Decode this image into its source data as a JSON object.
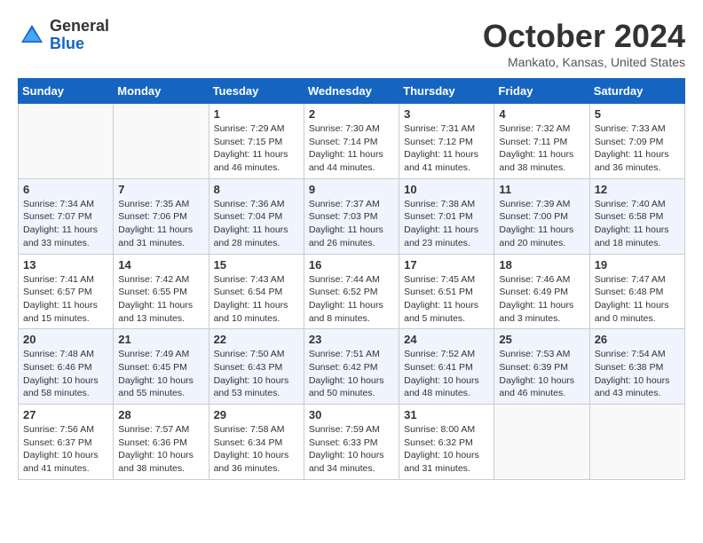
{
  "header": {
    "logo_general": "General",
    "logo_blue": "Blue",
    "month_title": "October 2024",
    "location": "Mankato, Kansas, United States"
  },
  "days_of_week": [
    "Sunday",
    "Monday",
    "Tuesday",
    "Wednesday",
    "Thursday",
    "Friday",
    "Saturday"
  ],
  "weeks": [
    [
      {
        "day": "",
        "sunrise": "",
        "sunset": "",
        "daylight": ""
      },
      {
        "day": "",
        "sunrise": "",
        "sunset": "",
        "daylight": ""
      },
      {
        "day": "1",
        "sunrise": "Sunrise: 7:29 AM",
        "sunset": "Sunset: 7:15 PM",
        "daylight": "Daylight: 11 hours and 46 minutes."
      },
      {
        "day": "2",
        "sunrise": "Sunrise: 7:30 AM",
        "sunset": "Sunset: 7:14 PM",
        "daylight": "Daylight: 11 hours and 44 minutes."
      },
      {
        "day": "3",
        "sunrise": "Sunrise: 7:31 AM",
        "sunset": "Sunset: 7:12 PM",
        "daylight": "Daylight: 11 hours and 41 minutes."
      },
      {
        "day": "4",
        "sunrise": "Sunrise: 7:32 AM",
        "sunset": "Sunset: 7:11 PM",
        "daylight": "Daylight: 11 hours and 38 minutes."
      },
      {
        "day": "5",
        "sunrise": "Sunrise: 7:33 AM",
        "sunset": "Sunset: 7:09 PM",
        "daylight": "Daylight: 11 hours and 36 minutes."
      }
    ],
    [
      {
        "day": "6",
        "sunrise": "Sunrise: 7:34 AM",
        "sunset": "Sunset: 7:07 PM",
        "daylight": "Daylight: 11 hours and 33 minutes."
      },
      {
        "day": "7",
        "sunrise": "Sunrise: 7:35 AM",
        "sunset": "Sunset: 7:06 PM",
        "daylight": "Daylight: 11 hours and 31 minutes."
      },
      {
        "day": "8",
        "sunrise": "Sunrise: 7:36 AM",
        "sunset": "Sunset: 7:04 PM",
        "daylight": "Daylight: 11 hours and 28 minutes."
      },
      {
        "day": "9",
        "sunrise": "Sunrise: 7:37 AM",
        "sunset": "Sunset: 7:03 PM",
        "daylight": "Daylight: 11 hours and 26 minutes."
      },
      {
        "day": "10",
        "sunrise": "Sunrise: 7:38 AM",
        "sunset": "Sunset: 7:01 PM",
        "daylight": "Daylight: 11 hours and 23 minutes."
      },
      {
        "day": "11",
        "sunrise": "Sunrise: 7:39 AM",
        "sunset": "Sunset: 7:00 PM",
        "daylight": "Daylight: 11 hours and 20 minutes."
      },
      {
        "day": "12",
        "sunrise": "Sunrise: 7:40 AM",
        "sunset": "Sunset: 6:58 PM",
        "daylight": "Daylight: 11 hours and 18 minutes."
      }
    ],
    [
      {
        "day": "13",
        "sunrise": "Sunrise: 7:41 AM",
        "sunset": "Sunset: 6:57 PM",
        "daylight": "Daylight: 11 hours and 15 minutes."
      },
      {
        "day": "14",
        "sunrise": "Sunrise: 7:42 AM",
        "sunset": "Sunset: 6:55 PM",
        "daylight": "Daylight: 11 hours and 13 minutes."
      },
      {
        "day": "15",
        "sunrise": "Sunrise: 7:43 AM",
        "sunset": "Sunset: 6:54 PM",
        "daylight": "Daylight: 11 hours and 10 minutes."
      },
      {
        "day": "16",
        "sunrise": "Sunrise: 7:44 AM",
        "sunset": "Sunset: 6:52 PM",
        "daylight": "Daylight: 11 hours and 8 minutes."
      },
      {
        "day": "17",
        "sunrise": "Sunrise: 7:45 AM",
        "sunset": "Sunset: 6:51 PM",
        "daylight": "Daylight: 11 hours and 5 minutes."
      },
      {
        "day": "18",
        "sunrise": "Sunrise: 7:46 AM",
        "sunset": "Sunset: 6:49 PM",
        "daylight": "Daylight: 11 hours and 3 minutes."
      },
      {
        "day": "19",
        "sunrise": "Sunrise: 7:47 AM",
        "sunset": "Sunset: 6:48 PM",
        "daylight": "Daylight: 11 hours and 0 minutes."
      }
    ],
    [
      {
        "day": "20",
        "sunrise": "Sunrise: 7:48 AM",
        "sunset": "Sunset: 6:46 PM",
        "daylight": "Daylight: 10 hours and 58 minutes."
      },
      {
        "day": "21",
        "sunrise": "Sunrise: 7:49 AM",
        "sunset": "Sunset: 6:45 PM",
        "daylight": "Daylight: 10 hours and 55 minutes."
      },
      {
        "day": "22",
        "sunrise": "Sunrise: 7:50 AM",
        "sunset": "Sunset: 6:43 PM",
        "daylight": "Daylight: 10 hours and 53 minutes."
      },
      {
        "day": "23",
        "sunrise": "Sunrise: 7:51 AM",
        "sunset": "Sunset: 6:42 PM",
        "daylight": "Daylight: 10 hours and 50 minutes."
      },
      {
        "day": "24",
        "sunrise": "Sunrise: 7:52 AM",
        "sunset": "Sunset: 6:41 PM",
        "daylight": "Daylight: 10 hours and 48 minutes."
      },
      {
        "day": "25",
        "sunrise": "Sunrise: 7:53 AM",
        "sunset": "Sunset: 6:39 PM",
        "daylight": "Daylight: 10 hours and 46 minutes."
      },
      {
        "day": "26",
        "sunrise": "Sunrise: 7:54 AM",
        "sunset": "Sunset: 6:38 PM",
        "daylight": "Daylight: 10 hours and 43 minutes."
      }
    ],
    [
      {
        "day": "27",
        "sunrise": "Sunrise: 7:56 AM",
        "sunset": "Sunset: 6:37 PM",
        "daylight": "Daylight: 10 hours and 41 minutes."
      },
      {
        "day": "28",
        "sunrise": "Sunrise: 7:57 AM",
        "sunset": "Sunset: 6:36 PM",
        "daylight": "Daylight: 10 hours and 38 minutes."
      },
      {
        "day": "29",
        "sunrise": "Sunrise: 7:58 AM",
        "sunset": "Sunset: 6:34 PM",
        "daylight": "Daylight: 10 hours and 36 minutes."
      },
      {
        "day": "30",
        "sunrise": "Sunrise: 7:59 AM",
        "sunset": "Sunset: 6:33 PM",
        "daylight": "Daylight: 10 hours and 34 minutes."
      },
      {
        "day": "31",
        "sunrise": "Sunrise: 8:00 AM",
        "sunset": "Sunset: 6:32 PM",
        "daylight": "Daylight: 10 hours and 31 minutes."
      },
      {
        "day": "",
        "sunrise": "",
        "sunset": "",
        "daylight": ""
      },
      {
        "day": "",
        "sunrise": "",
        "sunset": "",
        "daylight": ""
      }
    ]
  ]
}
